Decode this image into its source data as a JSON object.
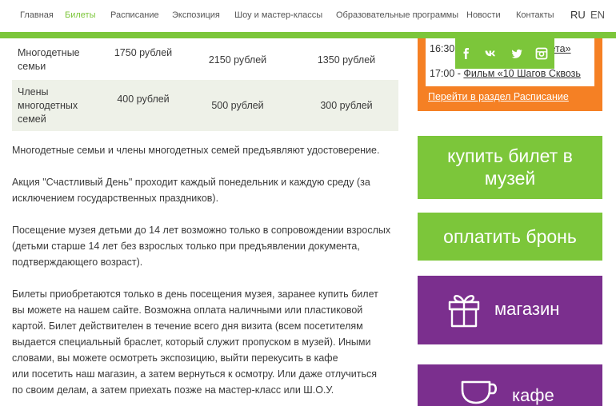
{
  "nav": {
    "items": [
      "Главная",
      "Билеты",
      "Расписание",
      "Экспозиция",
      "Шоу и мастер-классы",
      "Образовательные программы",
      "Новости",
      "Контакты"
    ],
    "active": "Билеты",
    "lang_ru": "RU",
    "lang_en": "EN"
  },
  "price_table": {
    "rows": [
      {
        "category": "Многодетные семьи",
        "price_1": "1750 рублей",
        "price_2": "2150 рублей",
        "price_3": "1350 рублей"
      },
      {
        "category": "Члены многодетных семей",
        "price_1": "400 рублей",
        "price_2": "500 рублей",
        "price_3": "300 рублей"
      }
    ]
  },
  "content": {
    "p1": [
      "Многодетные семьи и члены многодетных семей предъявляют удостоверение."
    ],
    "p2": [
      "Акция \"Счастливый День\" проходит каждый понедельник и каждую среду (за",
      "исключением государственных праздников)."
    ],
    "p3": [
      "Посещение музея детьми до 14 лет возможно только в сопровождении взрослых",
      "(детьми старше 14 лет без взрослых только при предъявлении документа,",
      "подтверждающего возраст)."
    ],
    "p4": [
      "Билеты приобретаются только в день посещения музея, заранее купить билет",
      "вы можете на нашем сайте. Возможна оплата наличными или пластиковой",
      "картой. Билет действителен в течение всего дня визита (всем посетителям",
      "выдается специальный браслет, который служит пропуском в музей). Иными",
      "словами, вы можете осмотреть экспозицию, выйти перекусить в кафе",
      "или посетить наш магазин, а затем вернуться к осмотру. Или даже отлучиться",
      "по своим делам, а затем приехать позже на мастер-класс или Ш.О.У."
    ]
  },
  "sidebar": {
    "schedule": {
      "line1_time": "16:30",
      "line1_film": "вета»",
      "line2_time": "17:00 -",
      "line2_film": "Фильм «10 Шагов Сквозь",
      "link": "Перейти в раздел Расписание"
    },
    "social_icons": [
      "facebook-icon",
      "vk-icon",
      "twitter-icon",
      "instagram-icon"
    ],
    "buy_button": [
      "купить билет в",
      "музей"
    ],
    "pay_button": "оплатить бронь",
    "shop_button": "магазин",
    "cafe_button": "кафе"
  },
  "colors": {
    "green": "#7cc63a",
    "orange": "#f58024",
    "purple": "#7b2f8e",
    "table_stripe": "#eef1e8"
  }
}
